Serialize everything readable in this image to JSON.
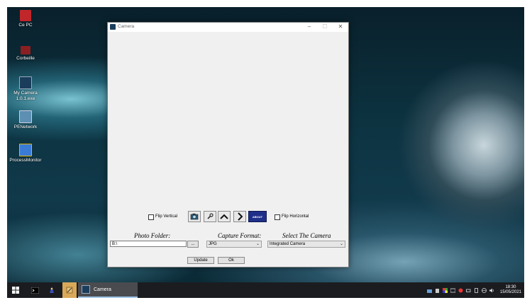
{
  "desktop": {
    "icons": [
      {
        "label": "Ce PC",
        "icon": "computer-icon",
        "color": "#c0262a"
      },
      {
        "label": "Corbeille",
        "icon": "recycle-bin-icon",
        "color": "#8a1f22"
      },
      {
        "label": "My Camera 1.0.1.exe",
        "icon": "camera-app-icon",
        "color": "#1b3d5c"
      },
      {
        "label": "PENetwork",
        "icon": "network-icon",
        "color": "#5c8fb2"
      },
      {
        "label": "ProcessMonitor",
        "icon": "process-monitor-icon",
        "color": "#3a7bd5"
      }
    ]
  },
  "window": {
    "title": "Camera",
    "controls": {
      "minimize": "–",
      "maximize": "☐",
      "close": "✕"
    },
    "flip_vertical_label": "Flip Vertical",
    "flip_horizontal_label": "Flip Horizontal",
    "about_label": "ABOUT",
    "photo_folder_label": "Photo Folder:",
    "photo_folder_value": "B:\\",
    "browse_label": "...",
    "capture_format_label": "Capture Format:",
    "capture_format_value": "JPG",
    "select_camera_label": "Select The Camera",
    "select_camera_value": "Integrated Camera",
    "update_label": "Update",
    "ok_label": "Ok"
  },
  "taskbar": {
    "active_app": "Camera",
    "clock_time": "18:30",
    "clock_date": "15/05/2021"
  },
  "colors": {
    "taskbar": "#1b1c20",
    "about_button": "#1e2f8a",
    "window_bg": "#f0f0f0"
  }
}
